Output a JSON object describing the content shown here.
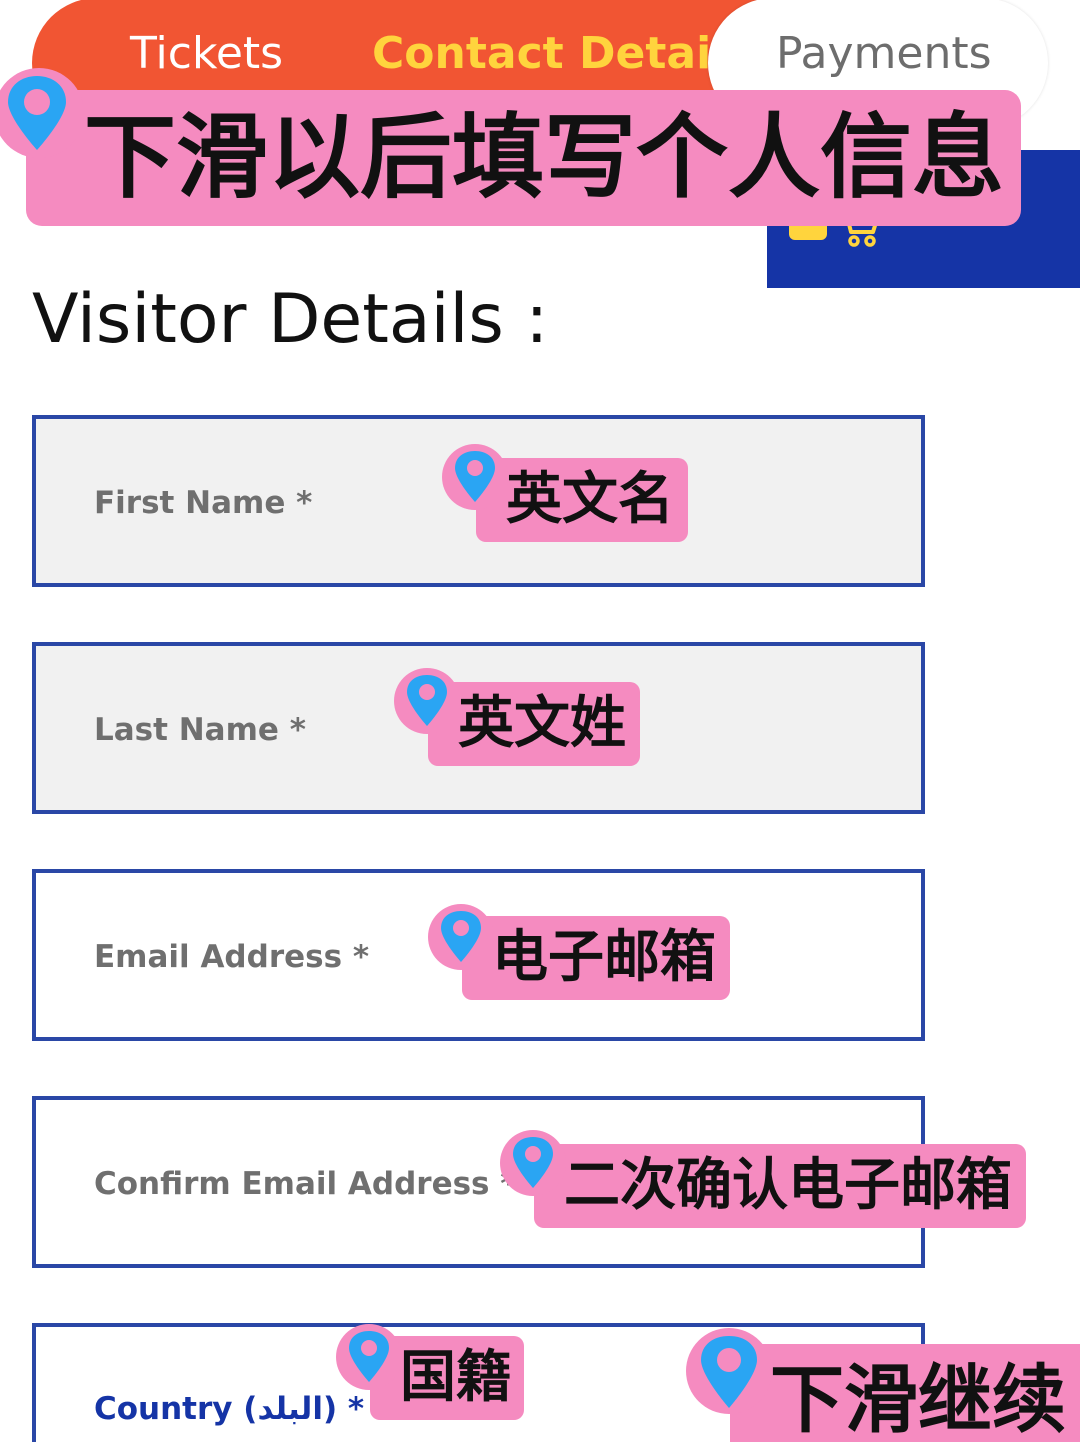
{
  "steps": {
    "tickets": "Tickets",
    "contact": "Contact Details",
    "payments": "Payments",
    "active": "Contact Details"
  },
  "section_title": "Visitor Details :",
  "fields": [
    {
      "label": "First Name *",
      "note": "英文名"
    },
    {
      "label": "Last Name *",
      "note": "英文姓"
    },
    {
      "label": "Email Address *",
      "note": "电子邮箱"
    },
    {
      "label": "Confirm Email Address *",
      "note": "二次确认电子邮箱"
    },
    {
      "label": "Country (البلد) *",
      "note": "国籍"
    }
  ],
  "annotations": {
    "header": "下滑以后填写个人信息",
    "scroll": "下滑继续"
  },
  "colors": {
    "step_bar": "#f15533",
    "active_step": "#ffd43d",
    "brand_blue": "#1534a6",
    "field_border": "#2a47a6",
    "sticker_pink": "#f58bc0",
    "pin_blue": "#2aa5f3"
  },
  "icons": {
    "cart": "shopping-cart-icon",
    "pin": "map-pin-icon"
  }
}
